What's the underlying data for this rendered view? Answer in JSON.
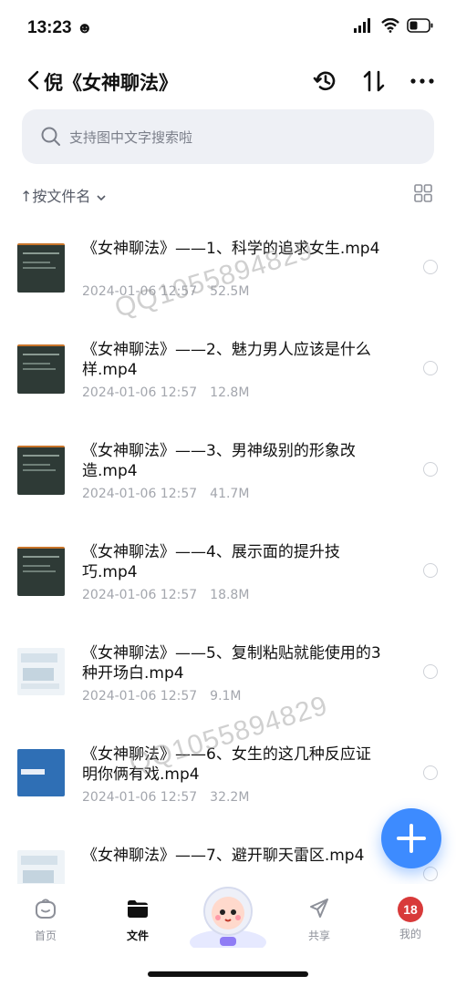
{
  "status_bar": {
    "time": "13:23"
  },
  "nav": {
    "title": "倪《女神聊法》"
  },
  "search": {
    "placeholder": "支持图中文字搜索啦"
  },
  "sort": {
    "label": "↑按文件名"
  },
  "files": [
    {
      "name": "《女神聊法》——1、科学的追求女生.mp4",
      "date": "2024-01-06 12:57",
      "size": "52.5M"
    },
    {
      "name": "《女神聊法》——2、魅力男人应该是什么样.mp4",
      "date": "2024-01-06 12:57",
      "size": "12.8M"
    },
    {
      "name": "《女神聊法》——3、男神级别的形象改造.mp4",
      "date": "2024-01-06 12:57",
      "size": "41.7M"
    },
    {
      "name": "《女神聊法》——4、展示面的提升技巧.mp4",
      "date": "2024-01-06 12:57",
      "size": "18.8M"
    },
    {
      "name": "《女神聊法》——5、复制粘贴就能使用的3种开场白.mp4",
      "date": "2024-01-06 12:57",
      "size": "9.1M"
    },
    {
      "name": "《女神聊法》——6、女生的这几种反应证明你俩有戏.mp4",
      "date": "2024-01-06 12:57",
      "size": "32.2M"
    },
    {
      "name": "《女神聊法》——7、避开聊天雷区.mp4",
      "date": "",
      "size": ""
    }
  ],
  "watermark": {
    "text": "QQ1055894829"
  },
  "tabbar": {
    "home": "首页",
    "files": "文件",
    "share": "共享",
    "me": "我的",
    "badge": "18"
  },
  "icons": {
    "back": "chevron-left-icon",
    "history": "history-icon",
    "sort": "sort-arrows-icon",
    "more": "more-dots-icon",
    "search": "search-icon",
    "grid": "grid-view-icon",
    "add": "plus-icon"
  },
  "colors": {
    "accent": "#3d8bff",
    "thumb_dark": "#2e3a36",
    "thumb_blue": "#2f6fb5"
  }
}
